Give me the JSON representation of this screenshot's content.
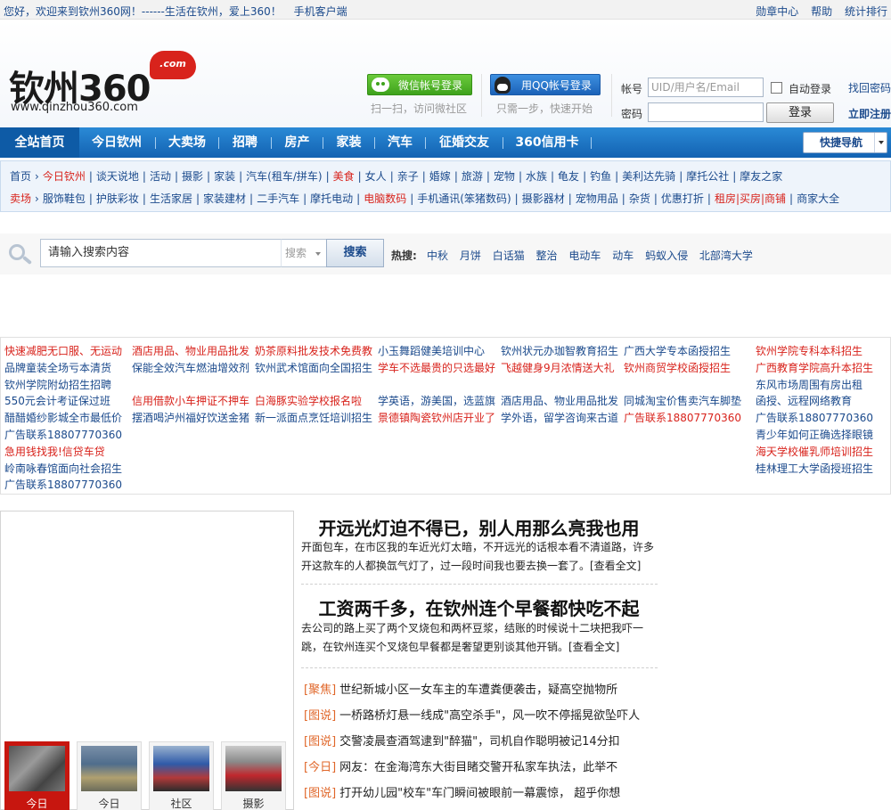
{
  "topbar": {
    "welcome": "您好，欢迎来到钦州360网！------生活在钦州，爱上360！",
    "mobile": "手机客户端",
    "links": [
      "勋章中心",
      "帮助",
      "统计排行"
    ]
  },
  "logo": {
    "text": "钦州360",
    "com": ".com",
    "url": "www.qinzhou360.com"
  },
  "social": {
    "wechat_label": "微信帐号登录",
    "wechat_tip": "扫一扫，访问微社区",
    "qq_label": "用QQ帐号登录",
    "qq_tip": "只需一步，快速开始"
  },
  "login": {
    "account_label": "帐号",
    "account_placeholder": "UID/用户名/Email",
    "password_label": "密码",
    "auto_login": "自动登录",
    "login_button": "登录",
    "find_password": "找回密码",
    "register": "立即注册"
  },
  "nav": {
    "items": [
      "全站首页",
      "今日钦州",
      "大卖场",
      "招聘",
      "房产",
      "家装",
      "汽车",
      "征婚交友",
      "360信用卡"
    ],
    "quick_nav": "快捷导航"
  },
  "sublinks": {
    "row1": [
      {
        "text": "首页",
        "red": false
      },
      {
        "text": "今日钦州",
        "red": true
      },
      {
        "text": "谈天说地",
        "red": false
      },
      {
        "text": "活动",
        "red": false
      },
      {
        "text": "摄影",
        "red": false
      },
      {
        "text": "家装",
        "red": false
      },
      {
        "text": "汽车(租车/拼车)",
        "red": false
      },
      {
        "text": "美食",
        "red": true
      },
      {
        "text": "女人",
        "red": false
      },
      {
        "text": "亲子",
        "red": false
      },
      {
        "text": "婚嫁",
        "red": false
      },
      {
        "text": "旅游",
        "red": false
      },
      {
        "text": "宠物",
        "red": false
      },
      {
        "text": "水族",
        "red": false
      },
      {
        "text": "龟友",
        "red": false
      },
      {
        "text": "钓鱼",
        "red": false
      },
      {
        "text": "美利达先骑",
        "red": false
      },
      {
        "text": "摩托公社",
        "red": false
      },
      {
        "text": "摩友之家",
        "red": false
      }
    ],
    "row2": [
      {
        "text": "卖场",
        "red": true
      },
      {
        "text": "服饰鞋包",
        "red": false
      },
      {
        "text": "护肤彩妆",
        "red": false
      },
      {
        "text": "生活家居",
        "red": false
      },
      {
        "text": "家装建材",
        "red": false
      },
      {
        "text": "二手汽车",
        "red": false
      },
      {
        "text": "摩托电动",
        "red": false
      },
      {
        "text": "电脑数码",
        "red": true
      },
      {
        "text": "手机通讯(笨猪数码)",
        "red": false
      },
      {
        "text": "摄影器材",
        "red": false
      },
      {
        "text": "宠物用品",
        "red": false
      },
      {
        "text": "杂货",
        "red": false
      },
      {
        "text": "优惠打折",
        "red": false
      },
      {
        "text": "租房|买房|商铺",
        "red": true
      },
      {
        "text": "商家大全",
        "red": false
      }
    ]
  },
  "search": {
    "placeholder": "请输入搜索内容",
    "type": "搜索",
    "button": "搜索",
    "hot_label": "热搜:",
    "hot_words": [
      "中秋",
      "月饼",
      "白话猫",
      "整治",
      "电动车",
      "动车",
      "蚂蚁入侵",
      "北部湾大学"
    ]
  },
  "ads": {
    "col1": [
      {
        "text": "快速减肥无口服、无运动",
        "color": "red"
      },
      {
        "text": "品牌童装全场亏本清货",
        "color": "blue"
      },
      {
        "text": "钦州学院附幼招生招聘",
        "color": "blue"
      },
      {
        "text": "550元会计考证保过班",
        "color": "blue"
      },
      {
        "text": "醋醋婚纱影城全市最低价",
        "color": "blue"
      },
      {
        "text": "广告联系18807770360",
        "color": "blue"
      },
      {
        "text": "急用钱找我!信贷车贷",
        "color": "red"
      },
      {
        "text": "岭南咏春馆面向社会招生",
        "color": "blue"
      },
      {
        "text": "广告联系18807770360",
        "color": "blue"
      }
    ],
    "col2": [
      {
        "text": "酒店用品、物业用品批发",
        "color": "red"
      },
      {
        "text": "保能全效汽车燃油增效剂",
        "color": "blue"
      },
      {
        "text": "",
        "color": "blue"
      },
      {
        "text": "信用借款小车押证不押车",
        "color": "red"
      },
      {
        "text": "摆酒喝泸州福好饮送金猪",
        "color": "blue"
      }
    ],
    "col3": [
      {
        "text": "奶茶原料批发技术免费教",
        "color": "red"
      },
      {
        "text": "钦州武术馆面向全国招生",
        "color": "blue"
      },
      {
        "text": "",
        "color": "blue"
      },
      {
        "text": "白海豚实验学校报名啦",
        "color": "red"
      },
      {
        "text": "新一派面点烹饪培训招生",
        "color": "blue"
      }
    ],
    "col4": [
      {
        "text": "小玉舞蹈健美培训中心",
        "color": "blue"
      },
      {
        "text": "学车不选最贵的只选最好",
        "color": "red"
      },
      {
        "text": "",
        "color": "blue"
      },
      {
        "text": "学英语，游美国，选蓝旗",
        "color": "blue"
      },
      {
        "text": "景德镇陶瓷钦州店开业了",
        "color": "red"
      }
    ],
    "col5": [
      {
        "text": "钦州状元办珈智教育招生",
        "color": "blue"
      },
      {
        "text": "飞越健身9月浓情送大礼",
        "color": "red"
      },
      {
        "text": "",
        "color": "blue"
      },
      {
        "text": "酒店用品、物业用品批发",
        "color": "blue"
      },
      {
        "text": "学外语，留学咨询来古道",
        "color": "blue"
      }
    ],
    "col6": [
      {
        "text": "广西大学专本函授招生",
        "color": "blue"
      },
      {
        "text": "钦州商贸学校函授招生",
        "color": "red"
      },
      {
        "text": "",
        "color": "blue"
      },
      {
        "text": "同城淘宝价售卖汽车脚垫",
        "color": "blue"
      },
      {
        "text": "广告联系18807770360",
        "color": "red"
      }
    ],
    "col7": [
      {
        "text": "钦州学院专科本科招生",
        "color": "red"
      },
      {
        "text": "广西教育学院高升本招生",
        "color": "red"
      },
      {
        "text": "东风市场周围有房出租",
        "color": "blue"
      },
      {
        "text": "函授、远程网络教育",
        "color": "blue"
      },
      {
        "text": "广告联系18807770360",
        "color": "blue"
      },
      {
        "text": "青少年如何正确选择眼镜",
        "color": "blue"
      },
      {
        "text": "海天学校催乳师培训招生",
        "color": "red"
      },
      {
        "text": "桂林理工大学函授班招生",
        "color": "blue"
      }
    ]
  },
  "slideshow": {
    "thumbs": [
      "今日",
      "今日",
      "社区",
      "摄影"
    ]
  },
  "headlines": [
    {
      "title": "开远光灯迫不得已，别人用那么亮我也用",
      "text": "开面包车，在市区我的车近光灯太暗，不开远光的话根本看不清道路，许多开这款车的人都换氙气灯了，过一段时间我也要去换一套了。[查看全文]"
    },
    {
      "title": "工资两千多，在钦州连个早餐都快吃不起",
      "text": "去公司的路上买了两个叉烧包和两杯豆浆，结账的时候说十二块把我吓一跳，在钦州连买个叉烧包早餐都是奢望更别谈其他开销。[查看全文]"
    }
  ],
  "news_list": [
    {
      "tag": "[聚焦]",
      "text": "世纪新城小区一女车主的车遭粪便袭击，疑高空抛物所"
    },
    {
      "tag": "[图说]",
      "text": "一桥路桥灯悬一线成\"高空杀手\"，风一吹不停摇晃欲坠吓人"
    },
    {
      "tag": "[图说]",
      "text": "交警凌晨查酒驾逮到\"醉猫\"，司机自作聪明被记14分扣"
    },
    {
      "tag": "[今日]",
      "text": "网友：在金海湾东大街目睹交警开私家车执法，此举不"
    },
    {
      "tag": "[图说]",
      "text": "打开幼儿园\"校车\"车门瞬间被眼前一幕震惊，  超乎你想"
    }
  ],
  "colors": {
    "nav_blue": "#1a72c4",
    "link_blue": "#1b4a8c",
    "red": "#d8231c",
    "tag_orange": "#e0672a"
  }
}
